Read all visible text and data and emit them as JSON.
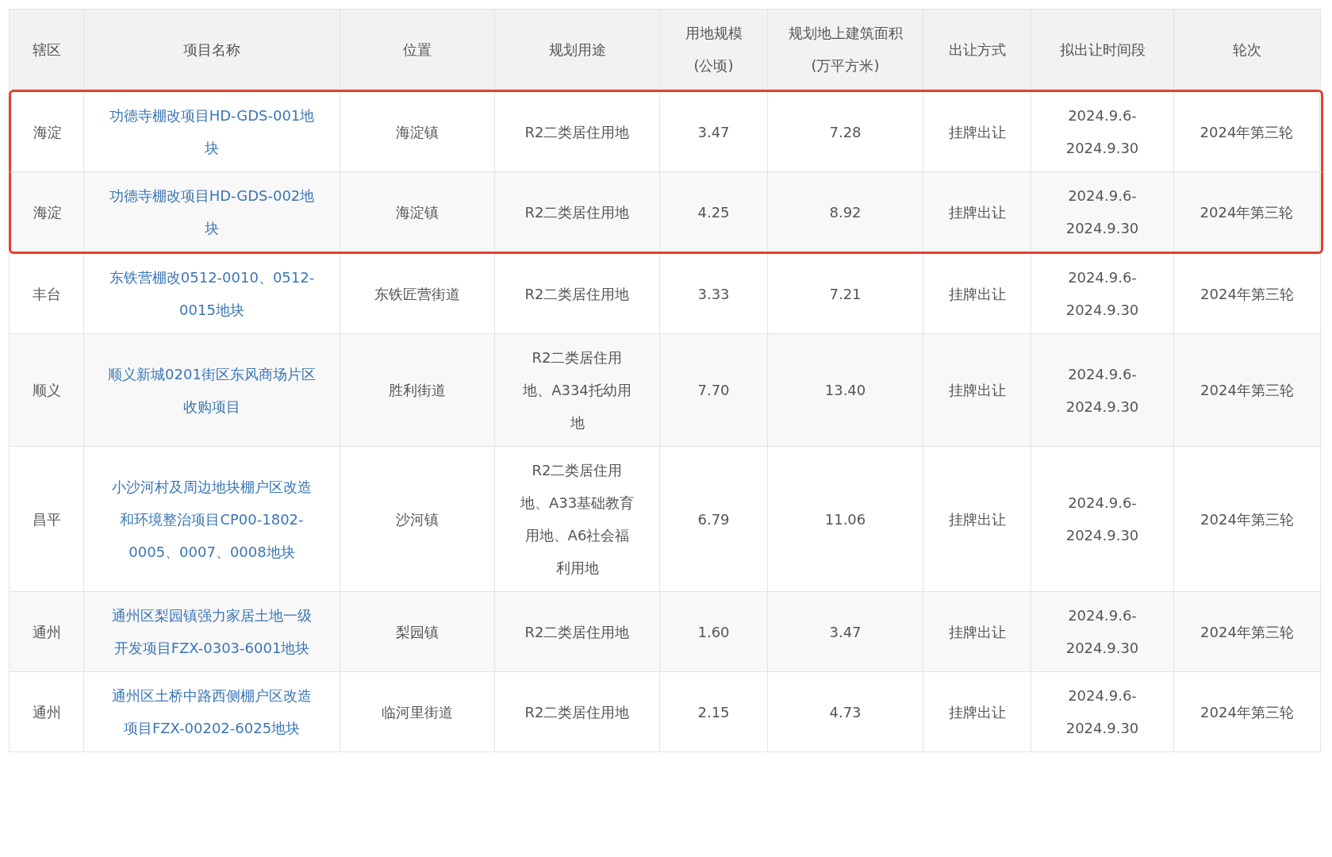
{
  "table": {
    "columns": [
      {
        "label": "辖区",
        "kind": "text"
      },
      {
        "label": "项目名称",
        "kind": "link"
      },
      {
        "label": "位置",
        "kind": "text"
      },
      {
        "label": "规划用途",
        "kind": "text"
      },
      {
        "label": "用地规模(公顷)",
        "kind": "text"
      },
      {
        "label": "规划地上建筑面积(万平方米)",
        "kind": "text"
      },
      {
        "label": "出让方式",
        "kind": "text"
      },
      {
        "label": "拟出让时间段",
        "kind": "text"
      },
      {
        "label": "轮次",
        "kind": "text"
      }
    ],
    "rows": [
      {
        "highlighted": true,
        "cells": [
          "海淀",
          "功德寺棚改项目HD-GDS-001地块",
          "海淀镇",
          "R2二类居住用地",
          "3.47",
          "7.28",
          "挂牌出让",
          "2024.9.6-2024.9.30",
          "2024年第三轮"
        ]
      },
      {
        "highlighted": true,
        "cells": [
          "海淀",
          "功德寺棚改项目HD-GDS-002地块",
          "海淀镇",
          "R2二类居住用地",
          "4.25",
          "8.92",
          "挂牌出让",
          "2024.9.6-2024.9.30",
          "2024年第三轮"
        ]
      },
      {
        "highlighted": false,
        "cells": [
          "丰台",
          "东铁营棚改0512-0010、0512-0015地块",
          "东铁匠营街道",
          "R2二类居住用地",
          "3.33",
          "7.21",
          "挂牌出让",
          "2024.9.6-2024.9.30",
          "2024年第三轮"
        ]
      },
      {
        "highlighted": false,
        "cells": [
          "顺义",
          "顺义新城0201街区东风商场片区收购项目",
          "胜利街道",
          "R2二类居住用地、A334托幼用地",
          "7.70",
          "13.40",
          "挂牌出让",
          "2024.9.6-2024.9.30",
          "2024年第三轮"
        ]
      },
      {
        "highlighted": false,
        "cells": [
          "昌平",
          "小沙河村及周边地块棚户区改造和环境整治项目CP00-1802-0005、0007、0008地块",
          "沙河镇",
          "R2二类居住用地、A33基础教育用地、A6社会福利用地",
          "6.79",
          "11.06",
          "挂牌出让",
          "2024.9.6-2024.9.30",
          "2024年第三轮"
        ]
      },
      {
        "highlighted": false,
        "cells": [
          "通州",
          "通州区梨园镇强力家居土地一级开发项目FZX-0303-6001地块",
          "梨园镇",
          "R2二类居住用地",
          "1.60",
          "3.47",
          "挂牌出让",
          "2024.9.6-2024.9.30",
          "2024年第三轮"
        ]
      },
      {
        "highlighted": false,
        "cells": [
          "通州",
          "通州区土桥中路西侧棚户区改造项目FZX-00202-6025地块",
          "临河里街道",
          "R2二类居住用地",
          "2.15",
          "4.73",
          "挂牌出让",
          "2024.9.6-2024.9.30",
          "2024年第三轮"
        ]
      }
    ]
  }
}
